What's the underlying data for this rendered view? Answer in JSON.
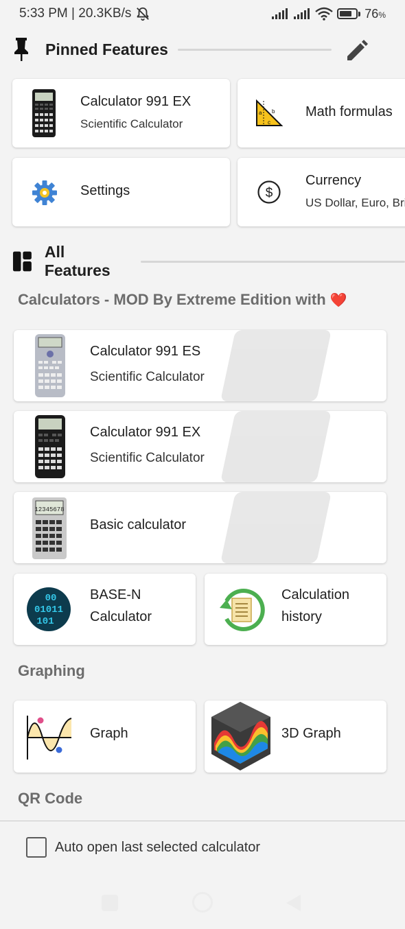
{
  "status_bar": {
    "time_speed": "5:33 PM | 20.3KB/s",
    "battery_percent": "76",
    "battery_suffix": "%",
    "battery_level": 0.76,
    "icons": [
      "mute-bell-icon",
      "signal-icon",
      "signal-icon",
      "wifi-icon",
      "battery-icon"
    ]
  },
  "pinned": {
    "title": "Pinned Features",
    "edit_icon": "pencil-icon",
    "items": [
      {
        "title": "Calculator 991 EX",
        "subtitle": "Scientific Calculator",
        "icon": "calculator-991ex-icon"
      },
      {
        "title": "Math formulas",
        "subtitle": "",
        "icon": "triangle-formula-icon"
      },
      {
        "title": "Settings",
        "subtitle": "",
        "icon": "gear-icon"
      },
      {
        "title": "Currency",
        "subtitle": "US Dollar, Euro, Brit",
        "icon": "dollar-icon"
      }
    ]
  },
  "all_features": {
    "title": "All Features",
    "icon": "dashboard-icon"
  },
  "calculators": {
    "label": "Calculators - MOD By Extreme Edition with",
    "heart": "❤️",
    "items": [
      {
        "title": "Calculator 991 ES",
        "subtitle": "Scientific Calculator",
        "icon": "calculator-991es-icon"
      },
      {
        "title": "Calculator 991 EX",
        "subtitle": "Scientific Calculator",
        "icon": "calculator-991ex-icon"
      },
      {
        "title": "Basic calculator",
        "subtitle": "",
        "icon": "basic-calculator-icon"
      },
      {
        "title": "BASE-N Calculator",
        "title_line1": "BASE-N",
        "title_line2": "Calculator",
        "icon": "binary-icon"
      },
      {
        "title": "Calculation history",
        "title_line1": "Calculation",
        "title_line2": "history",
        "icon": "history-icon"
      }
    ]
  },
  "graphing": {
    "label": "Graphing",
    "items": [
      {
        "title": "Graph",
        "icon": "graph-icon"
      },
      {
        "title": "3D Graph",
        "icon": "3d-graph-icon"
      }
    ]
  },
  "qr": {
    "label": "QR Code"
  },
  "footer": {
    "checkbox_label": "Auto open last selected calculator",
    "checked": false
  },
  "colors": {
    "background": "#f3f3f3",
    "card": "#ffffff",
    "section_label": "#6c6c6c",
    "accent_green": "#4caf50"
  }
}
